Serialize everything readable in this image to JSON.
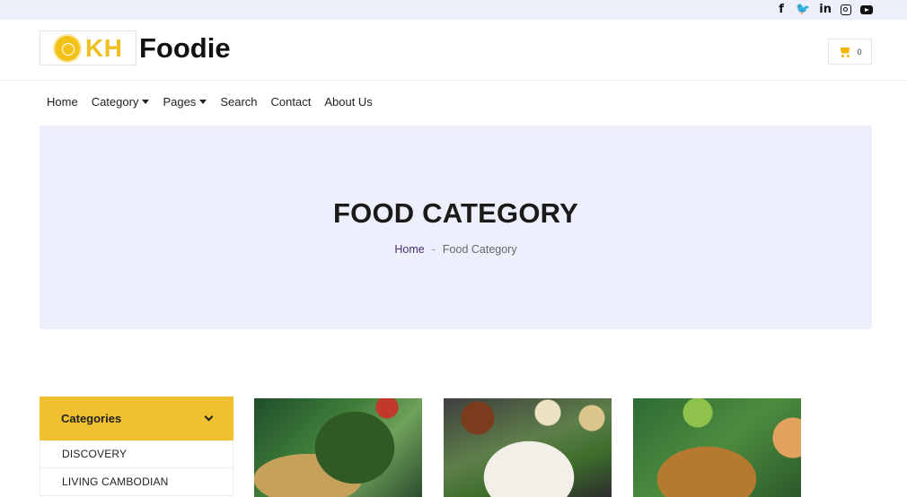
{
  "topbar": {
    "social": [
      {
        "name": "facebook-icon",
        "glyph": "f"
      },
      {
        "name": "twitter-icon",
        "glyph": "🐦"
      },
      {
        "name": "linkedin-icon",
        "glyph": "in"
      },
      {
        "name": "instagram-icon",
        "glyph": ""
      },
      {
        "name": "youtube-icon",
        "glyph": ""
      }
    ]
  },
  "header": {
    "logo_text": "KH",
    "brand": "Foodie",
    "cart_count": "0"
  },
  "nav": {
    "items": [
      {
        "label": "Home",
        "dropdown": false
      },
      {
        "label": "Category",
        "dropdown": true
      },
      {
        "label": "Pages",
        "dropdown": true
      },
      {
        "label": "Search",
        "dropdown": false
      },
      {
        "label": "Contact",
        "dropdown": false
      },
      {
        "label": "About Us",
        "dropdown": false
      }
    ]
  },
  "hero": {
    "title": "FOOD CATEGORY",
    "breadcrumb": {
      "home": "Home",
      "separator": "-",
      "current": "Food Category"
    }
  },
  "sidebar": {
    "title": "Categories",
    "items": [
      "DISCOVERY",
      "LIVING CAMBODIAN"
    ]
  },
  "cards": [
    {
      "name": "food-card-1",
      "image": "food-image-betel-leaf-dish"
    },
    {
      "name": "food-card-2",
      "image": "food-image-noodle-platter"
    },
    {
      "name": "food-card-3",
      "image": "food-image-green-curry-bowl"
    }
  ],
  "colors": {
    "accent": "#f0c030",
    "hero_bg": "#edf0fc",
    "topbar_bg": "#edf0fb",
    "breadcrumb_link": "#4a2e6f"
  }
}
